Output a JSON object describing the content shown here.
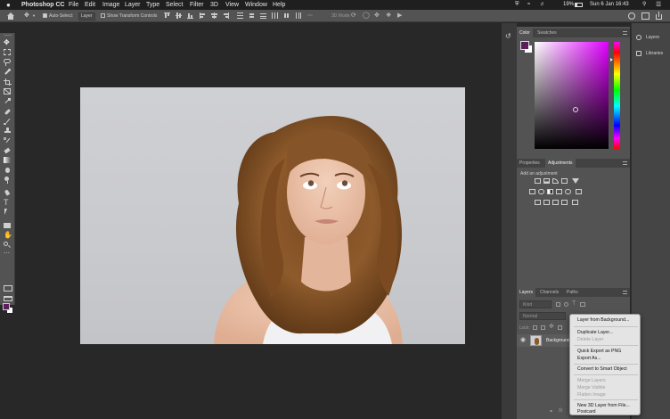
{
  "menubar": {
    "app": "Photoshop CC",
    "items": [
      "File",
      "Edit",
      "Image",
      "Layer",
      "Type",
      "Select",
      "Filter",
      "3D",
      "View",
      "Window",
      "Help"
    ],
    "battery": "19%",
    "datetime": "Sun 6 Jan 16:43"
  },
  "options": {
    "auto_select": "Auto-Select:",
    "auto_select_target": "Layer",
    "show_transform": "Show Transform Controls"
  },
  "color_panel": {
    "tabs": [
      "Color",
      "Swatches"
    ],
    "foreground": "#5a1f5c",
    "background": "#ffffff"
  },
  "adjust_panel": {
    "tabs": [
      "Properties",
      "Adjustments"
    ],
    "hint": "Add an adjustment"
  },
  "layers_panel": {
    "tabs": [
      "Layers",
      "Channels",
      "Paths"
    ],
    "kind_placeholder": "Kind",
    "blend_mode": "Normal",
    "lock_label": "Lock:",
    "layer_name": "Background"
  },
  "far_panel": {
    "items": [
      "Layers",
      "Libraries"
    ]
  },
  "context_menu": {
    "items": [
      {
        "label": "Layer from Background...",
        "enabled": true
      },
      {
        "label": "Duplicate Layer...",
        "enabled": true
      },
      {
        "label": "Delete Layer",
        "enabled": false
      },
      {
        "label": "Quick Export as PNG",
        "enabled": true
      },
      {
        "label": "Export As...",
        "enabled": true
      },
      {
        "label": "Convert to Smart Object",
        "enabled": true
      },
      {
        "label": "Merge Layers",
        "enabled": false
      },
      {
        "label": "Merge Visible",
        "enabled": false
      },
      {
        "label": "Flatten Image",
        "enabled": false
      },
      {
        "label": "New 3D Layer from File...",
        "enabled": true
      },
      {
        "label": "Postcard",
        "enabled": true
      }
    ]
  },
  "icons": {
    "tools": [
      "move-icon",
      "marquee-icon",
      "lasso-icon",
      "quick-select-icon",
      "crop-icon",
      "frame-icon",
      "eyedropper-icon",
      "healing-brush-icon",
      "brush-icon",
      "clone-stamp-icon",
      "history-brush-icon",
      "eraser-icon",
      "gradient-icon",
      "blur-icon",
      "dodge-icon",
      "pen-icon",
      "type-icon",
      "path-select-icon",
      "rectangle-icon",
      "hand-icon",
      "zoom-icon",
      "more-tools-icon"
    ]
  }
}
